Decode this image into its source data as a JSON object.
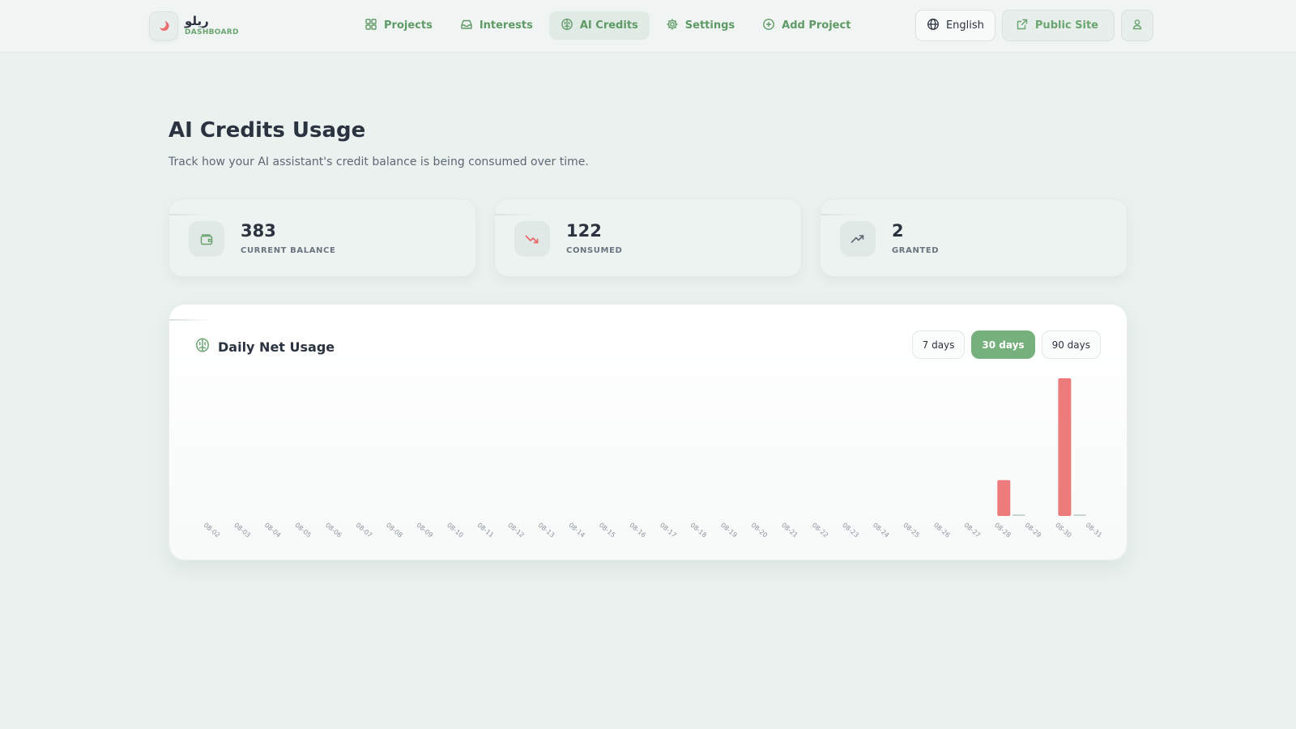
{
  "brand": {
    "name": "ريلو",
    "subtitle": "DASHBOARD"
  },
  "nav": [
    {
      "label": "Projects",
      "icon": "grid-icon",
      "active": false
    },
    {
      "label": "Interests",
      "icon": "inbox-icon",
      "active": false
    },
    {
      "label": "AI Credits",
      "icon": "brain-icon",
      "active": true
    },
    {
      "label": "Settings",
      "icon": "gear-icon",
      "active": false
    },
    {
      "label": "Add Project",
      "icon": "plus-circle-icon",
      "active": false
    }
  ],
  "tools": {
    "language": "English",
    "public_site": "Public Site"
  },
  "page": {
    "title": "AI Credits Usage",
    "description": "Track how your AI assistant's credit balance is being consumed over time."
  },
  "stats": [
    {
      "value": "383",
      "label": "CURRENT BALANCE",
      "icon": "wallet-icon"
    },
    {
      "value": "122",
      "label": "CONSUMED",
      "icon": "trending-down-icon"
    },
    {
      "value": "2",
      "label": "GRANTED",
      "icon": "trending-up-icon"
    }
  ],
  "chart": {
    "title": "Daily Net Usage",
    "ranges": [
      {
        "label": "7 days",
        "active": false
      },
      {
        "label": "30 days",
        "active": true
      },
      {
        "label": "90 days",
        "active": false
      }
    ]
  },
  "colors": {
    "accent": "#76b07c",
    "consumed": "#ee7b7b",
    "granted": "#c7d3cf"
  },
  "chart_data": {
    "type": "bar",
    "categories": [
      "08-02",
      "08-03",
      "08-04",
      "08-05",
      "08-06",
      "08-07",
      "08-08",
      "08-09",
      "08-10",
      "08-11",
      "08-12",
      "08-13",
      "08-14",
      "08-15",
      "08-16",
      "08-17",
      "08-18",
      "08-19",
      "08-20",
      "08-21",
      "08-22",
      "08-23",
      "08-24",
      "08-25",
      "08-26",
      "08-27",
      "08-28",
      "08-29",
      "08-30",
      "08-31"
    ],
    "series": [
      {
        "values": [
          0,
          0,
          0,
          0,
          0,
          0,
          0,
          0,
          0,
          0,
          0,
          0,
          0,
          0,
          0,
          0,
          0,
          0,
          0,
          0,
          0,
          0,
          0,
          0,
          0,
          0,
          26,
          0,
          100,
          0
        ]
      },
      {
        "values": [
          0,
          0,
          0,
          0,
          0,
          0,
          0,
          0,
          0,
          0,
          0,
          0,
          0,
          0,
          0,
          0,
          0,
          0,
          0,
          0,
          0,
          0,
          0,
          0,
          0,
          0,
          1,
          0,
          1,
          0
        ]
      }
    ],
    "ylim": [
      0,
      100
    ],
    "grid": false
  }
}
